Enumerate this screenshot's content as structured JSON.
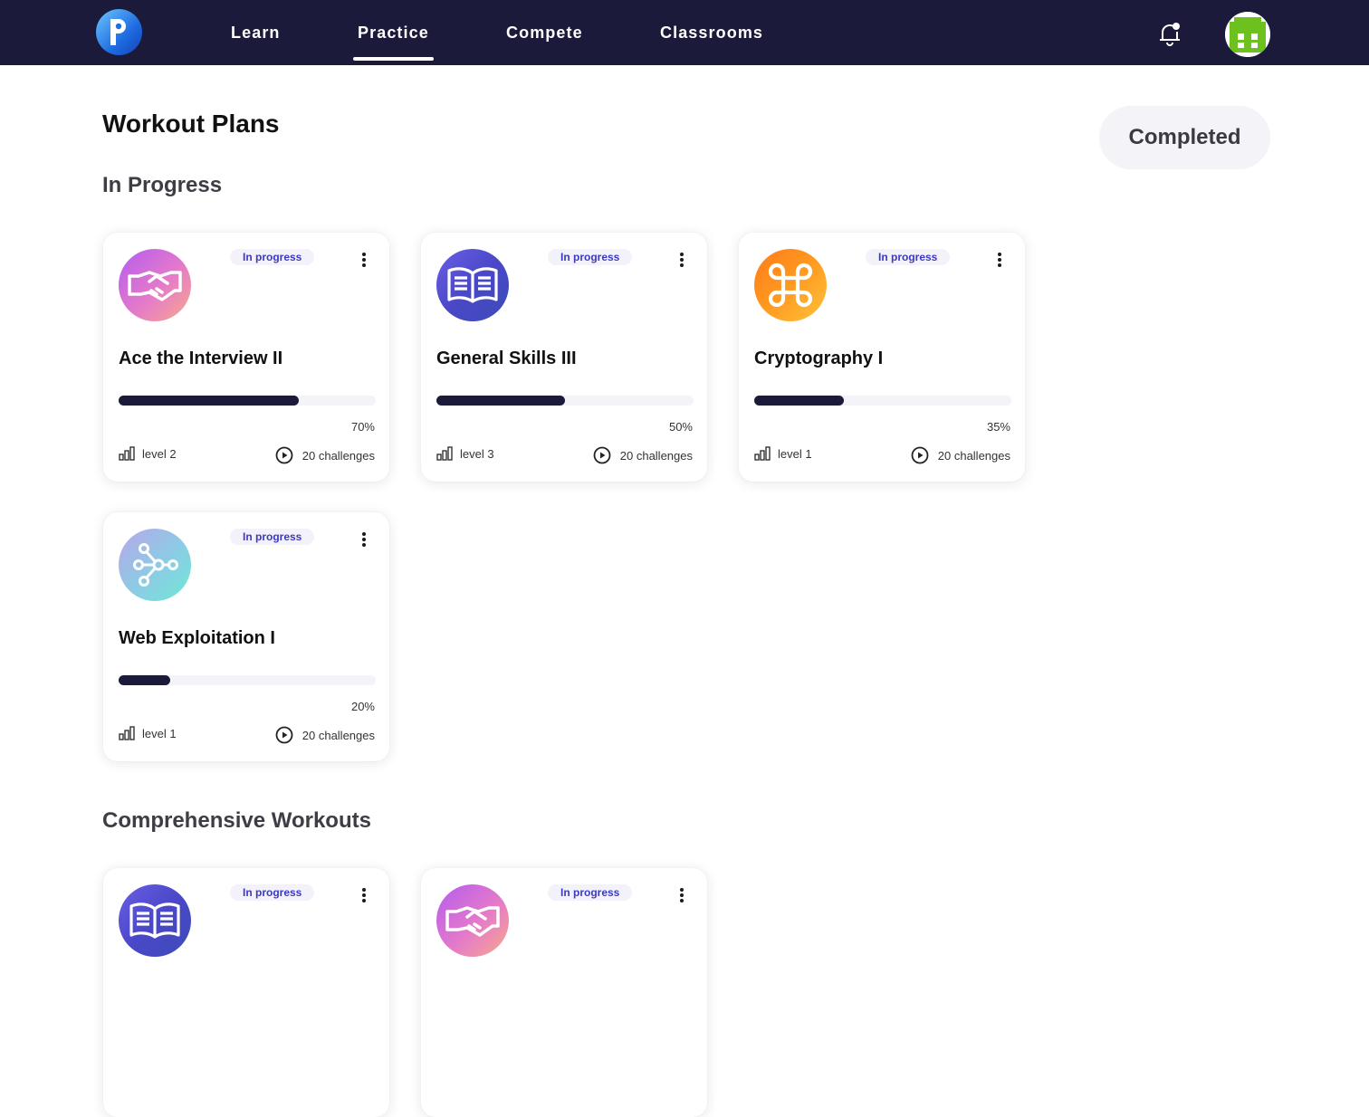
{
  "nav": {
    "items": [
      {
        "label": "Learn",
        "active": false
      },
      {
        "label": "Practice",
        "active": true
      },
      {
        "label": "Compete",
        "active": false
      },
      {
        "label": "Classrooms",
        "active": false
      }
    ]
  },
  "page": {
    "title": "Workout Plans",
    "completed_button": "Completed",
    "section_in_progress": "In Progress",
    "section_comprehensive": "Comprehensive Workouts"
  },
  "in_progress_cards": [
    {
      "icon": "handshake-icon",
      "badge": "In progress",
      "title": "Ace the Interview II",
      "progress": 0.7,
      "percent_label": "70%",
      "level": "level 2",
      "challenges": "20 challenges"
    },
    {
      "icon": "book-icon",
      "badge": "In progress",
      "title": "General Skills III",
      "progress": 0.5,
      "percent_label": "50%",
      "level": "level 3",
      "challenges": "20 challenges"
    },
    {
      "icon": "command-icon",
      "badge": "In progress",
      "title": "Cryptography I",
      "progress": 0.35,
      "percent_label": "35%",
      "level": "level 1",
      "challenges": "20 challenges"
    },
    {
      "icon": "network-icon",
      "badge": "In progress",
      "title": "Web Exploitation I",
      "progress": 0.2,
      "percent_label": "20%",
      "level": "level 1",
      "challenges": "20 challenges"
    }
  ],
  "comprehensive_cards": [
    {
      "icon": "book-icon",
      "badge": "In progress"
    },
    {
      "icon": "handshake-icon",
      "badge": "In progress"
    }
  ],
  "colors": {
    "nav_bg": "#1c1a3a",
    "progress_fill": "#1c1a3a",
    "badge_text": "#3b39c2",
    "badge_bg": "#f3f2fa"
  }
}
